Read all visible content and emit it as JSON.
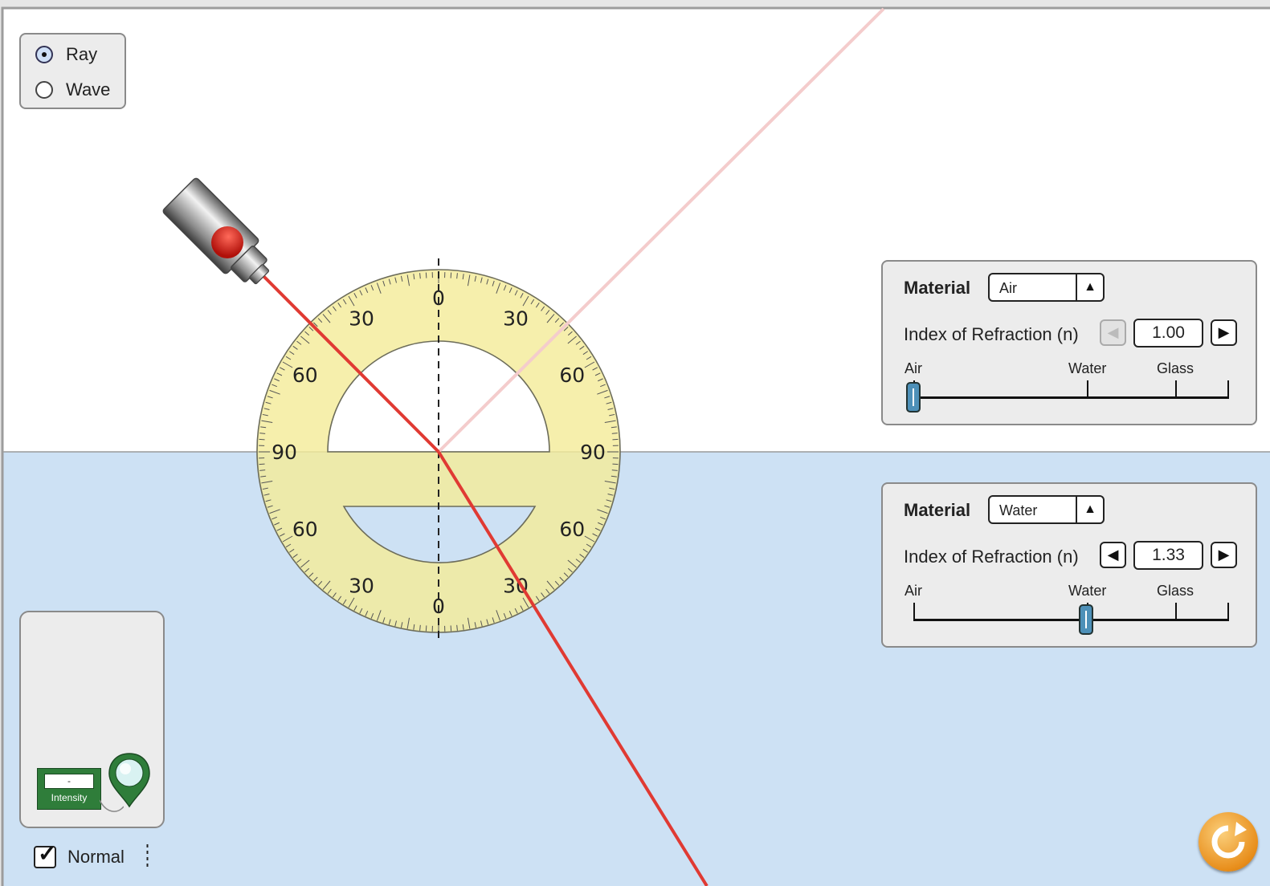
{
  "mode_selector": {
    "options": [
      {
        "label": "Ray",
        "selected": true
      },
      {
        "label": "Wave",
        "selected": false
      }
    ]
  },
  "top_medium": {
    "material_label": "Material",
    "material": "Air",
    "index_label": "Index of Refraction (n)",
    "index_value": "1.00",
    "slider_labels": [
      "Air",
      "Water",
      "Glass"
    ],
    "slider_fraction": 0.0,
    "left_arrow_enabled": false
  },
  "bottom_medium": {
    "material_label": "Material",
    "material": "Water",
    "index_label": "Index of Refraction (n)",
    "index_value": "1.33",
    "slider_labels": [
      "Air",
      "Water",
      "Glass"
    ],
    "slider_fraction": 0.55,
    "left_arrow_enabled": true
  },
  "protractor": {
    "tick_labels": [
      "0",
      "30",
      "60",
      "90",
      "60",
      "30",
      "0",
      "30",
      "60",
      "90",
      "60",
      "30"
    ]
  },
  "toolbox": {
    "intensity_value": "-",
    "intensity_label": "Intensity"
  },
  "normal_toggle": {
    "label": "Normal",
    "checked": true
  },
  "colors": {
    "top_medium_fill": "#ffffff",
    "bottom_medium_fill": "#cde1f4",
    "laser_beam": "#e03a33",
    "reflected_beam": "#f4cccc",
    "protractor_fill": "#f7f0a4",
    "sensor_green": "#2f7d3a",
    "reset_orange": "#e88e1b",
    "slider_thumb": "#4d90b8"
  },
  "icons": {
    "laser": "laser-pointer-icon",
    "reset": "reset-arrow-icon",
    "sensor": "intensity-probe-icon",
    "check": "check-mark-icon"
  }
}
